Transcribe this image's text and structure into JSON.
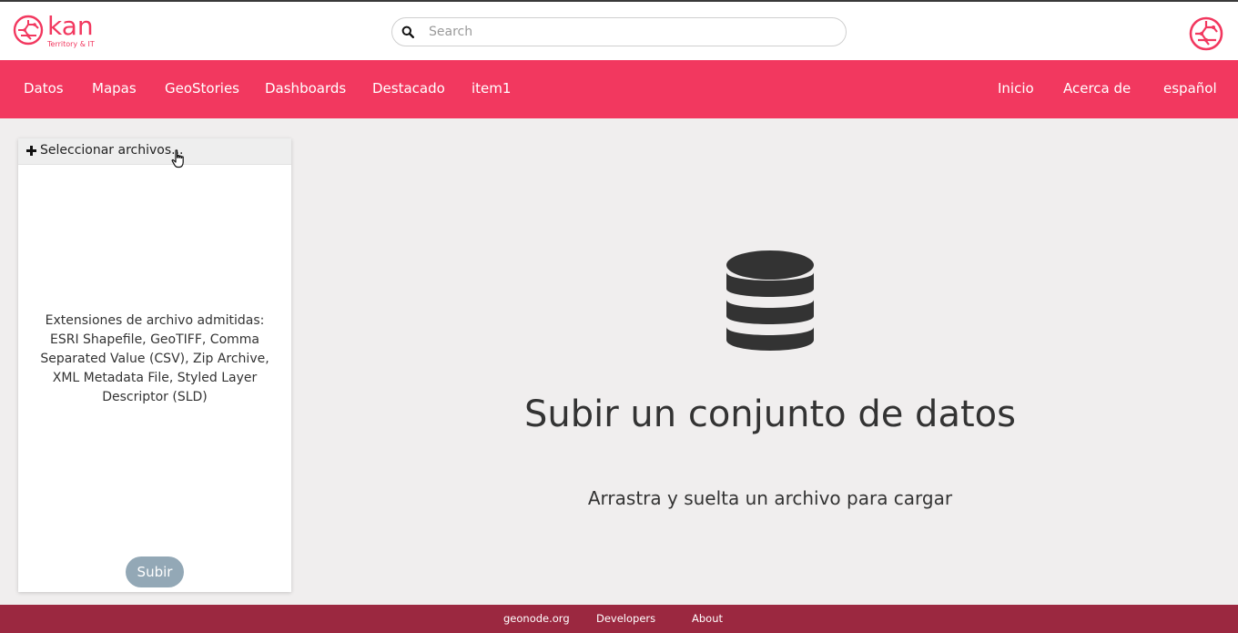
{
  "header": {
    "logo_word": "kan",
    "logo_tagline": "Territory & IT",
    "search": {
      "placeholder": "Search",
      "value": ""
    },
    "icons": {
      "search": "search-icon",
      "avatar": "user-avatar-icon"
    }
  },
  "nav": {
    "left": [
      "Datos",
      "Mapas",
      "GeoStories",
      "Dashboards",
      "Destacado",
      "item1"
    ],
    "right": [
      "Inicio",
      "Acerca de",
      "español"
    ]
  },
  "upload": {
    "select_label": "Seleccionar archivos...",
    "supported_extensions": "Extensiones de archivo admitidas: ESRI Shapefile, GeoTIFF, Comma Separated Value (CSV), Zip Archive, XML Metadata File, Styled Layer Descriptor (SLD)",
    "submit_label": "Subir"
  },
  "dropzone": {
    "title": "Subir un conjunto de datos",
    "subtitle": "Arrastra y suelta un archivo para cargar",
    "icon": "database-icon"
  },
  "footer": {
    "links": [
      "geonode.org",
      "Developers",
      "About"
    ]
  },
  "colors": {
    "brand": "#f2385f",
    "footer": "#9b2840",
    "background": "#f0eeee",
    "submit_disabled": "#93a8b6"
  }
}
